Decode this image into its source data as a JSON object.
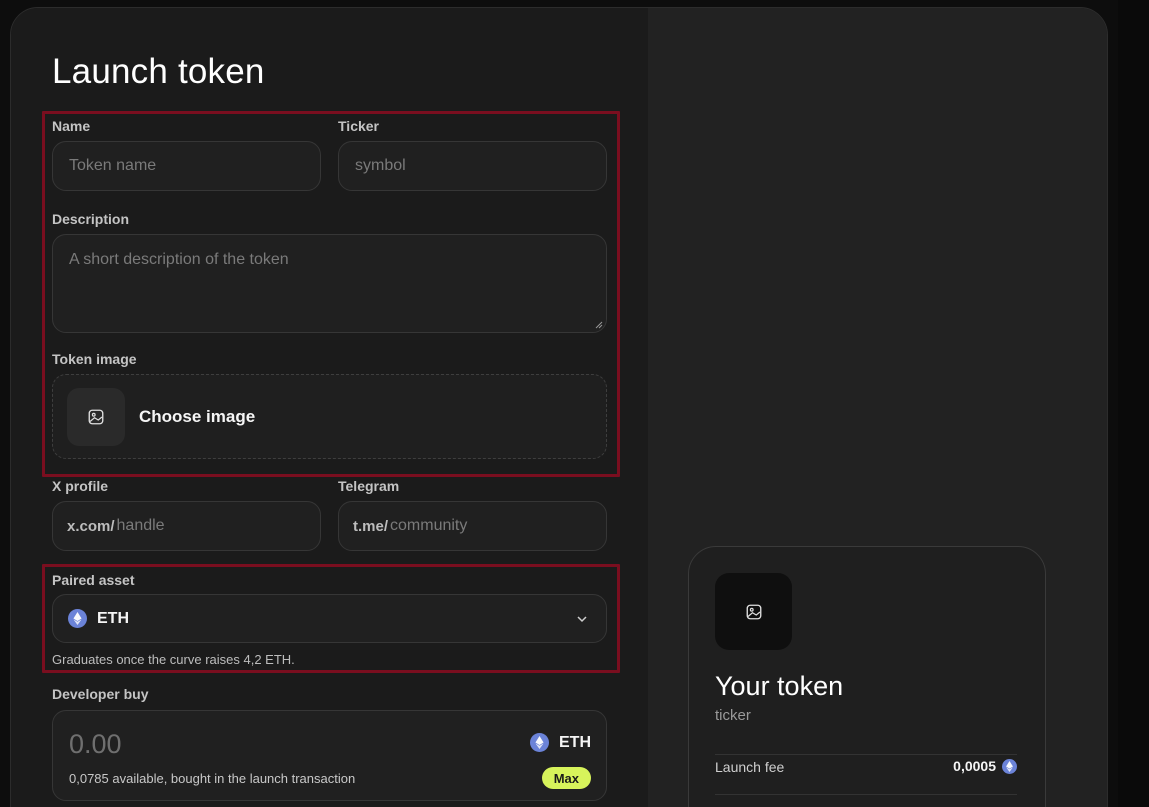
{
  "page": {
    "title": "Launch token"
  },
  "form": {
    "name": {
      "label": "Name",
      "placeholder": "Token name",
      "value": ""
    },
    "ticker": {
      "label": "Ticker",
      "placeholder": "symbol",
      "value": ""
    },
    "description": {
      "label": "Description",
      "placeholder": "A short description of the token"
    },
    "token_image": {
      "label": "Token image",
      "button_label": "Choose image",
      "icon": "image-icon"
    },
    "x_profile": {
      "label": "X profile",
      "prefix": "x.com/",
      "placeholder": "handle"
    },
    "telegram": {
      "label": "Telegram",
      "prefix": "t.me/",
      "placeholder": "community"
    },
    "paired_asset": {
      "label": "Paired asset",
      "selected": "ETH",
      "icon": "eth-icon",
      "hint": "Graduates once the curve raises 4,2 ETH."
    },
    "developer_buy": {
      "label": "Developer buy",
      "amount_placeholder": "0.00",
      "asset": "ETH",
      "note": "0,0785 available, bought in the launch transaction",
      "max_label": "Max"
    }
  },
  "preview": {
    "title": "Your token",
    "ticker": "ticker",
    "fee_label": "Launch fee",
    "fee_value": "0,0005"
  },
  "colors": {
    "accent": "#d7f35b",
    "highlight": "#7a0e1f",
    "eth": "#6b83d8",
    "background": "#1b1b1b"
  }
}
